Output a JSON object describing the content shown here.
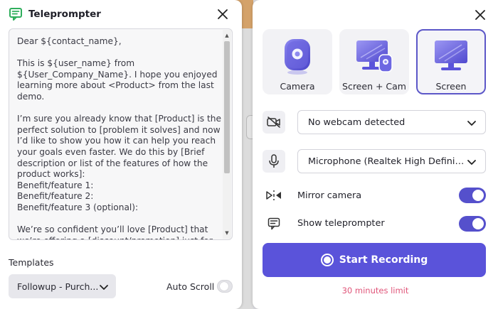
{
  "background": {
    "partial_text": "e"
  },
  "teleprompter": {
    "title": "Teleprompter",
    "script_text": "Dear ${contact_name},\n\nThis is ${user_name} from ${User_Company_Name}. I hope you enjoyed learning more about <Product> from the last demo.\n\nI’m sure you already know that [Product] is the perfect solution to [problem it solves] and now I’d like to show you how it can help you reach your goals even faster. We do this by [Brief description or list of the features of how the product works]:\nBenefit/feature 1:\nBenefit/feature 2:\nBenefit/feature 3 (optional):\n\nWe’re so confident you’ll love [Product] that we’re offering a [discount/promotion] just for you. Would it be possible if we can schedule a",
    "templates_label": "Templates",
    "template_selected": "Followup - Purch...",
    "auto_scroll_label": "Auto Scroll",
    "auto_scroll_on": false
  },
  "recorder": {
    "modes": [
      {
        "label": "Camera",
        "selected": false
      },
      {
        "label": "Screen + Cam",
        "selected": false
      },
      {
        "label": "Screen",
        "selected": true
      }
    ],
    "camera_select": "No webcam detected",
    "microphone_select": "Microphone (Realtek High Definition Audio)",
    "mirror_camera_label": "Mirror camera",
    "mirror_camera_on": true,
    "show_teleprompter_label": "Show teleprompter",
    "show_teleprompter_on": true,
    "start_button_label": "Start Recording",
    "limit_text": "30 minutes limit"
  },
  "colors": {
    "accent": "#5a53da",
    "accent_border": "#5c57c8",
    "limit_text": "#e0567a",
    "logo": "#2fae5c"
  },
  "icons": {
    "teleprompter_logo": "teleprompter-icon",
    "close": "close-icon",
    "camera_off": "camera-off-icon",
    "microphone": "microphone-icon",
    "mirror": "mirror-icon",
    "teleprompter_row": "teleprompter-icon",
    "chevron": "chevron-down-icon",
    "record": "record-icon"
  }
}
